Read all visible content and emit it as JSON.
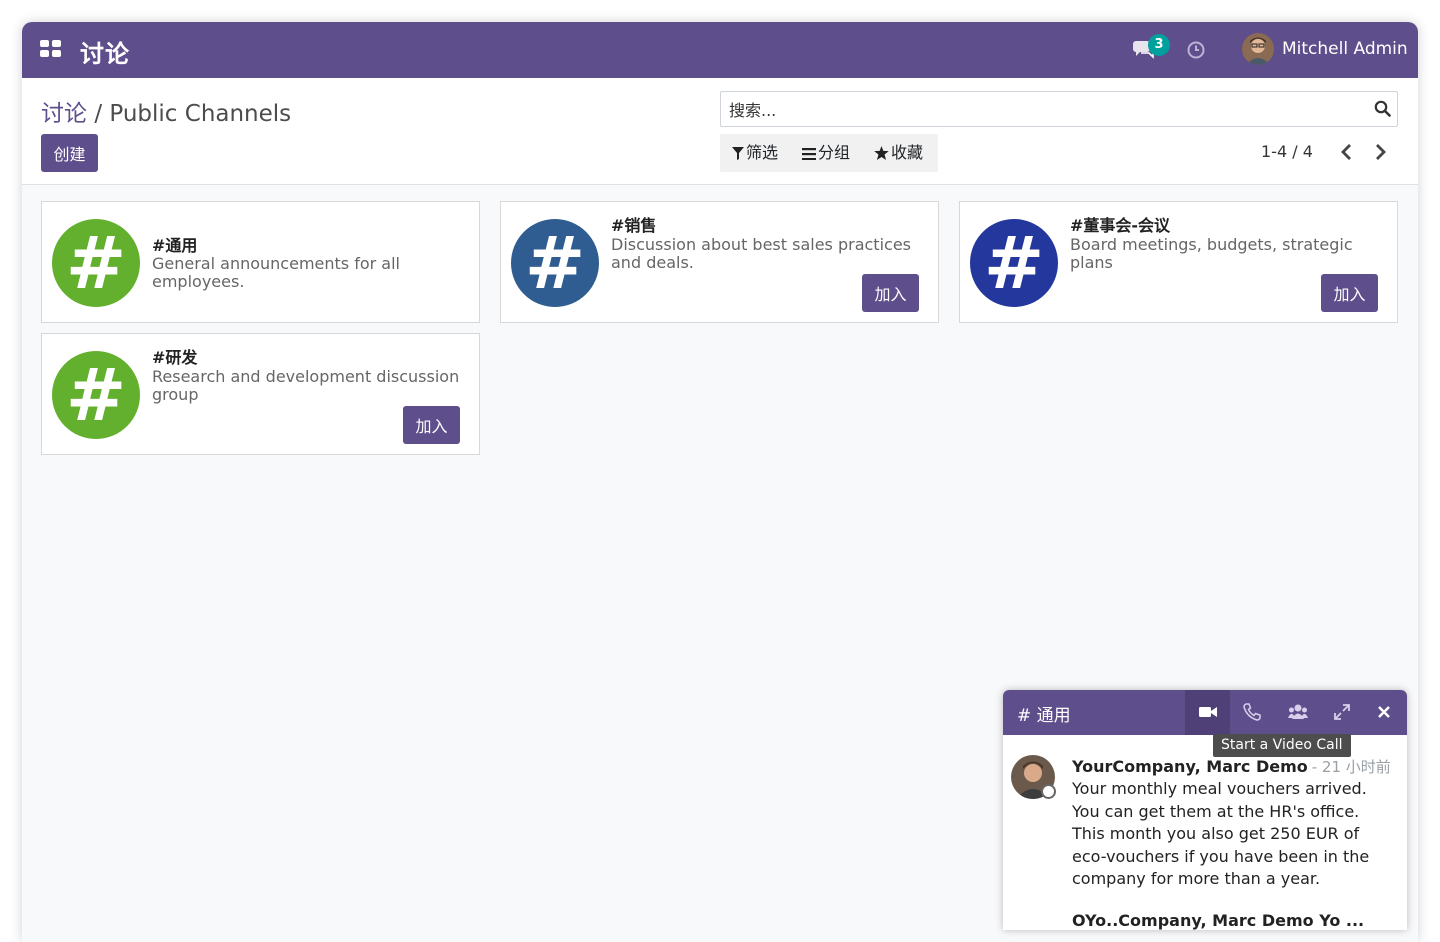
{
  "navbar": {
    "brand": "讨论",
    "message_count": "3",
    "username": "Mitchell Admin",
    "color": "#5f4e8c"
  },
  "control_panel": {
    "breadcrumb_parent": "讨论",
    "breadcrumb_separator": "/",
    "breadcrumb_current": "Public Channels",
    "create_label": "创建",
    "search_placeholder": "搜索...",
    "filters_label": "筛选",
    "groupby_label": "分组",
    "favorites_label": "收藏",
    "pager": "1-4 / 4"
  },
  "channels": [
    {
      "name": "#通用",
      "description": "General announcements for all employees.",
      "color": "#62b02d"
    },
    {
      "name": "#销售",
      "description": "Discussion about best sales practices and deals.",
      "join_label": "加入",
      "color": "#2f5c91"
    },
    {
      "name": "#董事会-会议",
      "description": "Board meetings, budgets, strategic plans",
      "join_label": "加入",
      "color": "#24379c"
    },
    {
      "name": "#研发",
      "description": "Research and development discussion group",
      "join_label": "加入",
      "color": "#62b02d"
    }
  ],
  "chat_window": {
    "title": "# 通用",
    "tooltip": "Start a Video Call",
    "icons": [
      "video-camera-icon",
      "phone-icon",
      "users-icon",
      "expand-icon",
      "close-icon"
    ],
    "message": {
      "author": "YourCompany, Marc Demo",
      "date": "- 21 小时前",
      "lines": [
        "Your monthly meal vouchers arrived. You can get them at the HR's office.",
        "This month you also get 250 EUR of eco-vouchers if you have been in the company for more than a year."
      ]
    },
    "next_author_partial": "OYo..Company, Marc Demo  Yo  ..."
  }
}
